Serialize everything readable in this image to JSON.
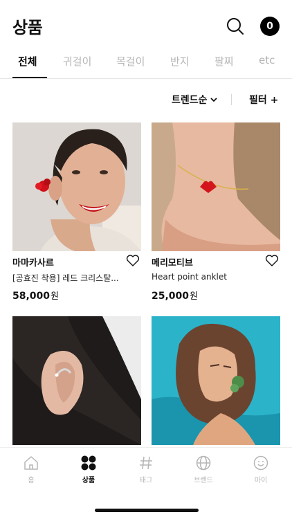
{
  "header": {
    "title": "상품",
    "cart_count": "0"
  },
  "tabs": [
    {
      "label": "전체",
      "active": true
    },
    {
      "label": "귀걸이",
      "active": false
    },
    {
      "label": "목걸이",
      "active": false
    },
    {
      "label": "반지",
      "active": false
    },
    {
      "label": "팔찌",
      "active": false
    },
    {
      "label": "etc",
      "active": false
    }
  ],
  "filter_bar": {
    "sort_label": "트렌드순",
    "filter_label": "필터 +"
  },
  "products": [
    {
      "brand": "마마카사르",
      "name": "[공효진 착용] 레드 크리스탈...",
      "price": "58,000",
      "currency": "원"
    },
    {
      "brand": "메리모티브",
      "name": "Heart point anklet",
      "price": "25,000",
      "currency": "원"
    },
    {
      "brand": "",
      "name": "",
      "price": "",
      "currency": ""
    },
    {
      "brand": "",
      "name": "",
      "price": "",
      "currency": ""
    }
  ],
  "bottom_nav": [
    {
      "label": "홈",
      "icon": "home-icon",
      "active": false
    },
    {
      "label": "상품",
      "icon": "grid-dots-icon",
      "active": true
    },
    {
      "label": "태그",
      "icon": "hash-icon",
      "active": false
    },
    {
      "label": "브랜드",
      "icon": "globe-icon",
      "active": false
    },
    {
      "label": "마이",
      "icon": "smiley-icon",
      "active": false
    }
  ]
}
